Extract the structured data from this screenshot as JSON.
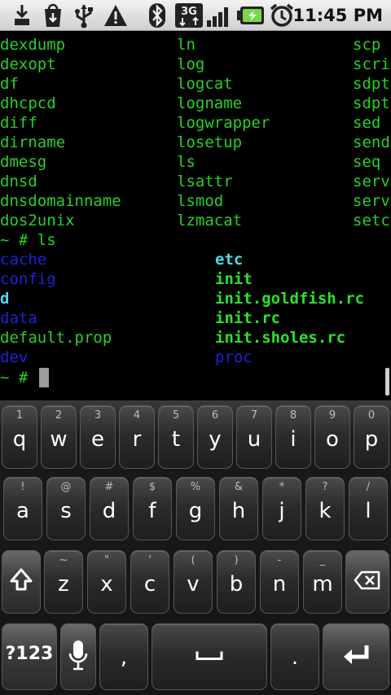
{
  "status_bar": {
    "time": "11:45 PM",
    "icons": [
      "usb-debugging-icon",
      "download-icon",
      "usb-icon",
      "warning-icon",
      "bluetooth-icon",
      "3g-data-icon",
      "signal-icon",
      "battery-icon",
      "alarm-icon"
    ],
    "network_label": "3G"
  },
  "terminal": {
    "colors": {
      "green": "#25d125",
      "blue": "#2020d8",
      "cyan": "#4fd8e8",
      "bright_green": "#27e427"
    },
    "listing_rows": [
      [
        "dexdump",
        "ln",
        "scp"
      ],
      [
        "dexopt",
        "log",
        "scri"
      ],
      [
        "df",
        "logcat",
        "sdpt"
      ],
      [
        "dhcpcd",
        "logname",
        "sdpt"
      ],
      [
        "diff",
        "logwrapper",
        "sed"
      ],
      [
        "dirname",
        "losetup",
        "send"
      ],
      [
        "dmesg",
        "ls",
        "seq"
      ],
      [
        "dnsd",
        "lsattr",
        "serv"
      ],
      [
        "dnsdomainname",
        "lsmod",
        "serv"
      ],
      [
        "dos2unix",
        "lzmacat",
        "setc"
      ]
    ],
    "command_line": "~ # ls",
    "ls_rows": [
      [
        "cache",
        "etc"
      ],
      [
        "config",
        "init"
      ],
      [
        "d",
        "init.goldfish.rc"
      ],
      [
        "data",
        "init.rc"
      ],
      [
        "default.prop",
        "init.sholes.rc"
      ],
      [
        "dev",
        "proc"
      ]
    ],
    "prompt": "~ #"
  },
  "keyboard": {
    "row1": [
      {
        "hint": "1",
        "key": "q"
      },
      {
        "hint": "2",
        "key": "w"
      },
      {
        "hint": "3",
        "key": "e"
      },
      {
        "hint": "4",
        "key": "r"
      },
      {
        "hint": "5",
        "key": "t"
      },
      {
        "hint": "6",
        "key": "y"
      },
      {
        "hint": "7",
        "key": "u"
      },
      {
        "hint": "8",
        "key": "i"
      },
      {
        "hint": "9",
        "key": "o"
      },
      {
        "hint": "0",
        "key": "p"
      }
    ],
    "row2": [
      {
        "hint": "!",
        "key": "a"
      },
      {
        "hint": "@",
        "key": "s"
      },
      {
        "hint": "#",
        "key": "d"
      },
      {
        "hint": "$",
        "key": "f"
      },
      {
        "hint": "%",
        "key": "g"
      },
      {
        "hint": "&",
        "key": "h"
      },
      {
        "hint": "*",
        "key": "j"
      },
      {
        "hint": "?",
        "key": "k"
      },
      {
        "hint": "/",
        "key": "l"
      }
    ],
    "row3": [
      {
        "hint": "~",
        "key": "z"
      },
      {
        "hint": "\"",
        "key": "x"
      },
      {
        "hint": "'",
        "key": "c"
      },
      {
        "hint": "(",
        "key": "v"
      },
      {
        "hint": ")",
        "key": "b"
      },
      {
        "hint": "-",
        "key": "n"
      },
      {
        "hint": "_",
        "key": "m"
      }
    ],
    "symbols_label": "?123",
    "comma_label": ",",
    "period_label": "."
  }
}
